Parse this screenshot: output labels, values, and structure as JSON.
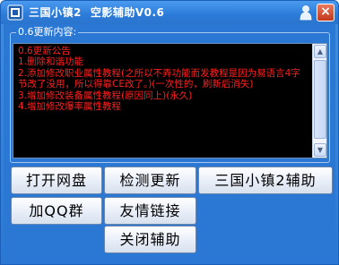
{
  "titlebar": {
    "app_name": "三国小镇2",
    "subtitle": "空影辅助V0.6",
    "close_label": "×"
  },
  "group": {
    "legend": "0.6更新内容:"
  },
  "changelog": {
    "text": "0.6更新公告\n1.删除和谐功能\n2.添加修改职业属性教程(之所以不弄功能而发教程是因为易语言4字节改了没用，所以得靠CE改了。)(一次性的，刷新后消失)\n3.增加修改装备属性教程(原因同上)(永久)\n4.增加修改爆率属性教程"
  },
  "buttons": {
    "open_netdisk": "打开网盘",
    "check_update": "检测更新",
    "game_helper": "三国小镇2辅助",
    "join_qq_group": "加QQ群",
    "friend_links": "友情链接",
    "close_helper": "关闭辅助"
  },
  "colors": {
    "window_blue": "#2b78d4",
    "changelog_text": "#ff2020",
    "changelog_bg": "#000000"
  }
}
